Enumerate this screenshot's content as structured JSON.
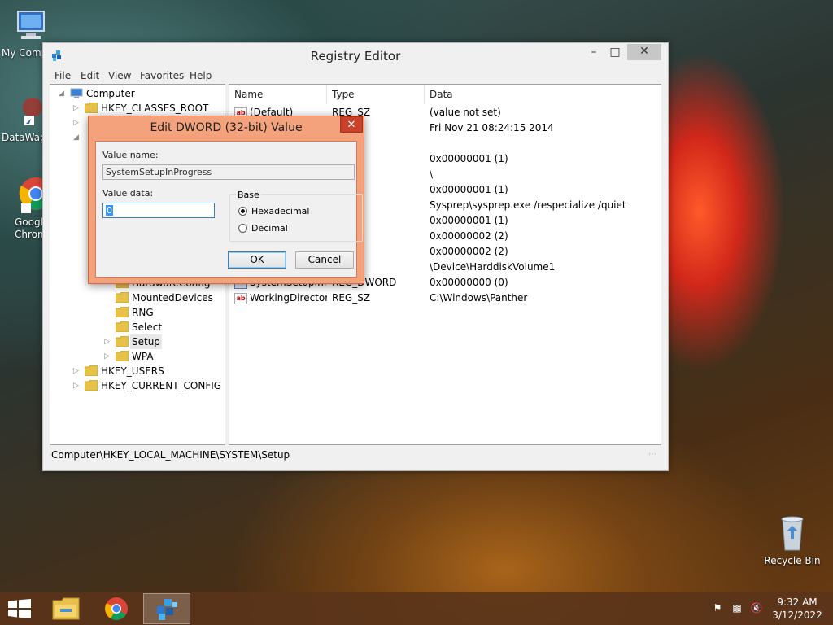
{
  "desktop": {
    "icons": [
      {
        "label": "My Comp"
      },
      {
        "label": "DataWag"
      },
      {
        "label": "Googl Chrom"
      },
      {
        "label": "Recycle Bin"
      }
    ]
  },
  "regedit": {
    "title": "Registry Editor",
    "window_buttons": {
      "minimize": "–",
      "maximize": "□",
      "close": "✕"
    },
    "menu": [
      "File",
      "Edit",
      "View",
      "Favorites",
      "Help"
    ],
    "tree": {
      "root": "Computer",
      "hkcr": "HKEY_CLASSES_ROOT",
      "hardware_config": "HardwareConfig",
      "mounted_devices": "MountedDevices",
      "rng": "RNG",
      "select": "Select",
      "setup": "Setup",
      "wpa": "WPA",
      "hku": "HKEY_USERS",
      "hkcc": "HKEY_CURRENT_CONFIG"
    },
    "columns": {
      "name": "Name",
      "type": "Type",
      "data": "Data"
    },
    "rows": [
      {
        "icon": "ab",
        "name": "(Default)",
        "type": "REG_SZ",
        "data": "(value not set)"
      },
      {
        "icon": "ab",
        "name": "",
        "type": "LTI_SZ",
        "data": "Fri Nov 21 08:24:15 2014"
      },
      {
        "icon": "",
        "name": "",
        "type": "",
        "data": ""
      },
      {
        "icon": "",
        "name": "",
        "type": "ORD",
        "data": "0x00000001 (1)"
      },
      {
        "icon": "",
        "name": "",
        "type": "",
        "data": "\\"
      },
      {
        "icon": "",
        "name": "",
        "type": "ORD",
        "data": "0x00000001 (1)"
      },
      {
        "icon": "",
        "name": "",
        "type": "",
        "data": "Sysprep\\sysprep.exe /respecialize /quiet"
      },
      {
        "icon": "",
        "name": "",
        "type": "ORD",
        "data": "0x00000001 (1)"
      },
      {
        "icon": "",
        "name": "",
        "type": "ORD",
        "data": "0x00000002 (2)"
      },
      {
        "icon": "",
        "name": "",
        "type": "ORD",
        "data": "0x00000002 (2)"
      },
      {
        "icon": "",
        "name": "",
        "type": "",
        "data": "\\Device\\HarddiskVolume1"
      },
      {
        "icon": "bin",
        "name": "SystemSetupInP...",
        "type": "REG_DWORD",
        "data": "0x00000000 (0)"
      },
      {
        "icon": "ab",
        "name": "WorkingDirectory",
        "type": "REG_SZ",
        "data": "C:\\Windows\\Panther"
      }
    ],
    "status": "Computer\\HKEY_LOCAL_MACHINE\\SYSTEM\\Setup"
  },
  "dialog": {
    "title": "Edit DWORD (32-bit) Value",
    "close": "✕",
    "value_name_label": "Value name:",
    "value_name": "SystemSetupInProgress",
    "value_data_label": "Value data:",
    "value_data": "0",
    "base_label": "Base",
    "hex_label": "Hexadecimal",
    "dec_label": "Decimal",
    "selected_base": "Hexadecimal",
    "ok": "OK",
    "cancel": "Cancel"
  },
  "taskbar": {
    "clock_time": "9:32 AM",
    "clock_date": "3/12/2022"
  },
  "colors": {
    "dialog_frame": "#f3a27b",
    "close_red": "#c7412b",
    "taskbar": "#5a341a"
  }
}
